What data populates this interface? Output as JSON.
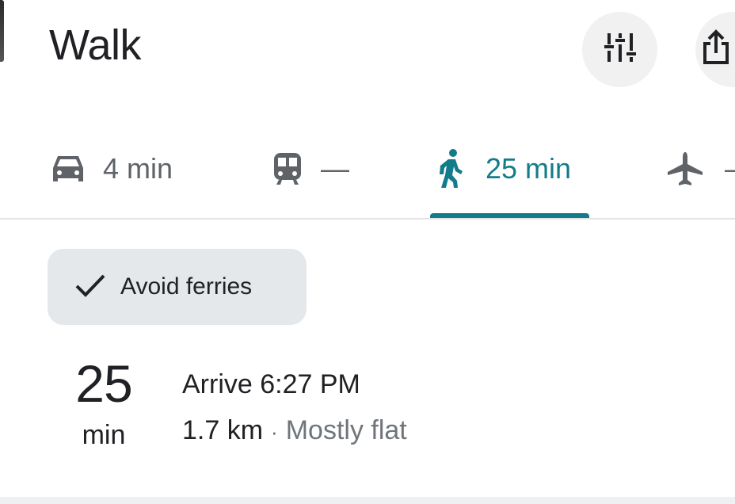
{
  "header": {
    "title": "Walk",
    "options_icon": "tune-sliders-icon",
    "share_icon": "share-icon"
  },
  "travel_modes": [
    {
      "mode": "drive",
      "icon": "car-icon",
      "label": "4 min",
      "selected": false
    },
    {
      "mode": "transit",
      "icon": "train-icon",
      "label": "—",
      "selected": false
    },
    {
      "mode": "walk",
      "icon": "walking-person-icon",
      "label": "25 min",
      "selected": true
    },
    {
      "mode": "flight",
      "icon": "airplane-icon",
      "label": "—",
      "selected": false
    }
  ],
  "filter_chip": {
    "icon": "check-icon",
    "label": "Avoid ferries"
  },
  "route": {
    "duration_value": "25",
    "duration_unit": "min",
    "arrival": "Arrive 6:27 PM",
    "distance": "1.7 km",
    "separator": "·",
    "terrain": "Mostly flat"
  },
  "colors": {
    "accent": "#137c8b",
    "chip_background": "#e4e8eb",
    "icon_gray": "#5f6368",
    "button_background": "#f1f1f1"
  }
}
